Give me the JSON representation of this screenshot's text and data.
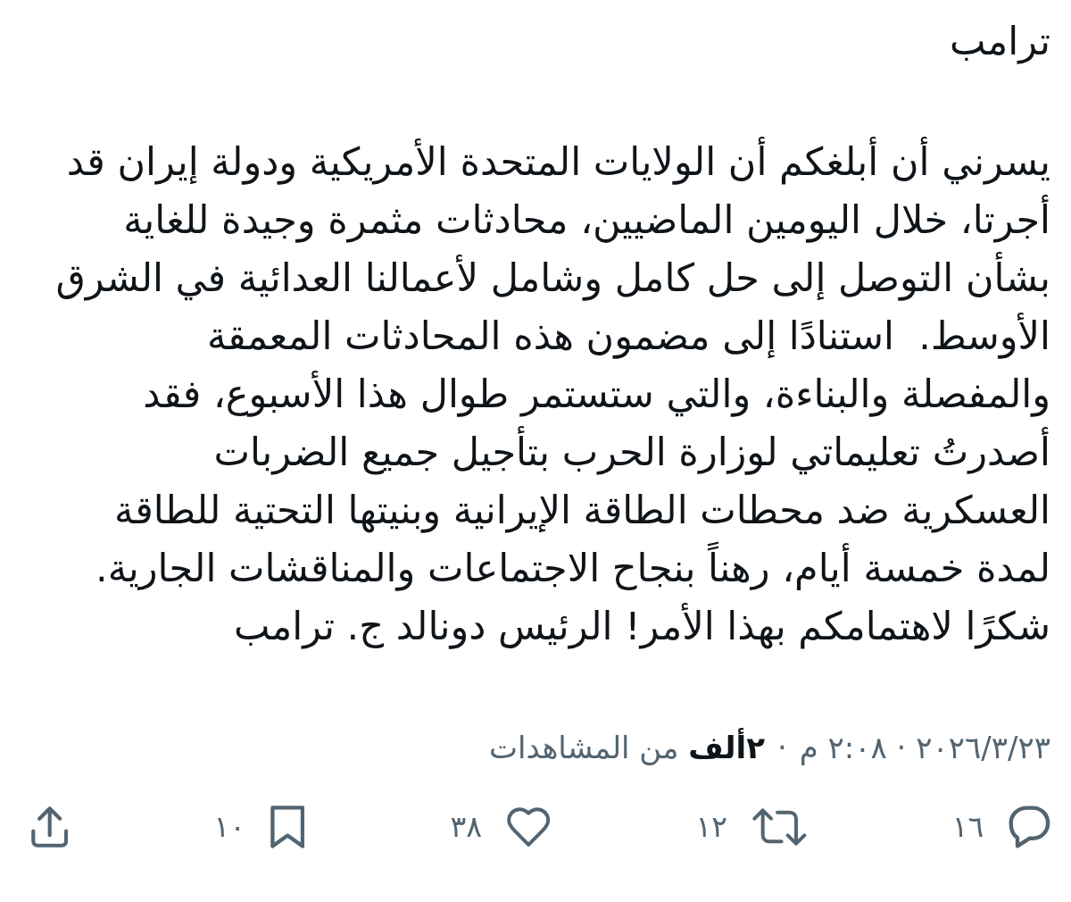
{
  "title": "ترامب",
  "text_lines": [
    "يسرني أن أبلغكم أن الولايات المتحدة الأمريكية ودولة إيران قد",
    "أجرتا، خلال اليومين الماضيين، محادثات مثمرة وجيدة للغاية",
    "بشأن التوصل إلى حل كامل وشامل لأعمالنا العدائية في الشرق",
    "الأوسط.  استنادًا إلى مضمون هذه المحادثات المعمقة",
    "والمفصلة والبناءة، والتي ستستمر طوال هذا الأسبوع، فقد",
    "أصدرتُ تعليماتي لوزارة الحرب بتأجيل جميع الضربات",
    "العسكرية ضد محطات الطاقة الإيرانية وبنيتها التحتية للطاقة",
    "لمدة خمسة أيام، رهناً بنجاح الاجتماعات والمناقشات الجارية.",
    "شكرًا لاهتمامكم بهذا الأمر! الرئيس دونالد ج. ترامب"
  ],
  "meta": {
    "timestamp": "٢٠٢٦/٣/٢٣ · ٢:٠٨ م",
    "separator": "·",
    "views": "**٢ألف** من المشاهدات"
  },
  "actions": [
    {
      "kind": "reply",
      "count": "١٦"
    },
    {
      "kind": "retweet",
      "count": "١٢"
    },
    {
      "kind": "like",
      "count": "٣٨"
    },
    {
      "kind": "bookmark",
      "count": "١٠"
    },
    {
      "kind": "share"
    }
  ]
}
